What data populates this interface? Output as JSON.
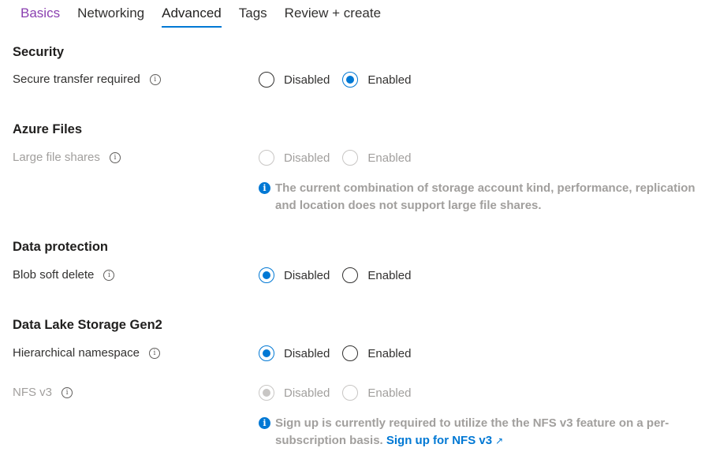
{
  "tabs": [
    {
      "label": "Basics",
      "state": "visited"
    },
    {
      "label": "Networking",
      "state": "normal"
    },
    {
      "label": "Advanced",
      "state": "active"
    },
    {
      "label": "Tags",
      "state": "normal"
    },
    {
      "label": "Review + create",
      "state": "normal"
    }
  ],
  "options": {
    "disabled": "Disabled",
    "enabled": "Enabled"
  },
  "sections": {
    "security": {
      "title": "Security",
      "secure_transfer": {
        "label": "Secure transfer required",
        "value": "Enabled",
        "enabled_control": true
      }
    },
    "azure_files": {
      "title": "Azure Files",
      "large_file_shares": {
        "label": "Large file shares",
        "value": null,
        "enabled_control": false
      },
      "note": "The current combination of storage account kind, performance, replication and location does not support large file shares."
    },
    "data_protection": {
      "title": "Data protection",
      "blob_soft_delete": {
        "label": "Blob soft delete",
        "value": "Disabled",
        "enabled_control": true
      }
    },
    "data_lake": {
      "title": "Data Lake Storage Gen2",
      "hierarchical_namespace": {
        "label": "Hierarchical namespace",
        "value": "Disabled",
        "enabled_control": true
      },
      "nfs_v3": {
        "label": "NFS v3",
        "value": "Disabled",
        "enabled_control": false
      },
      "note": "Sign up is currently required to utilize the the NFS v3 feature on a per-subscription basis.",
      "note_link": "Sign up for NFS v3"
    }
  },
  "icons": {
    "info": "info-icon",
    "info_filled": "info-filled-icon",
    "external": "external-link-icon"
  },
  "colors": {
    "accent": "#0078d4",
    "visited_tab": "#8a3fb0",
    "disabled_text": "#a19f9d"
  }
}
